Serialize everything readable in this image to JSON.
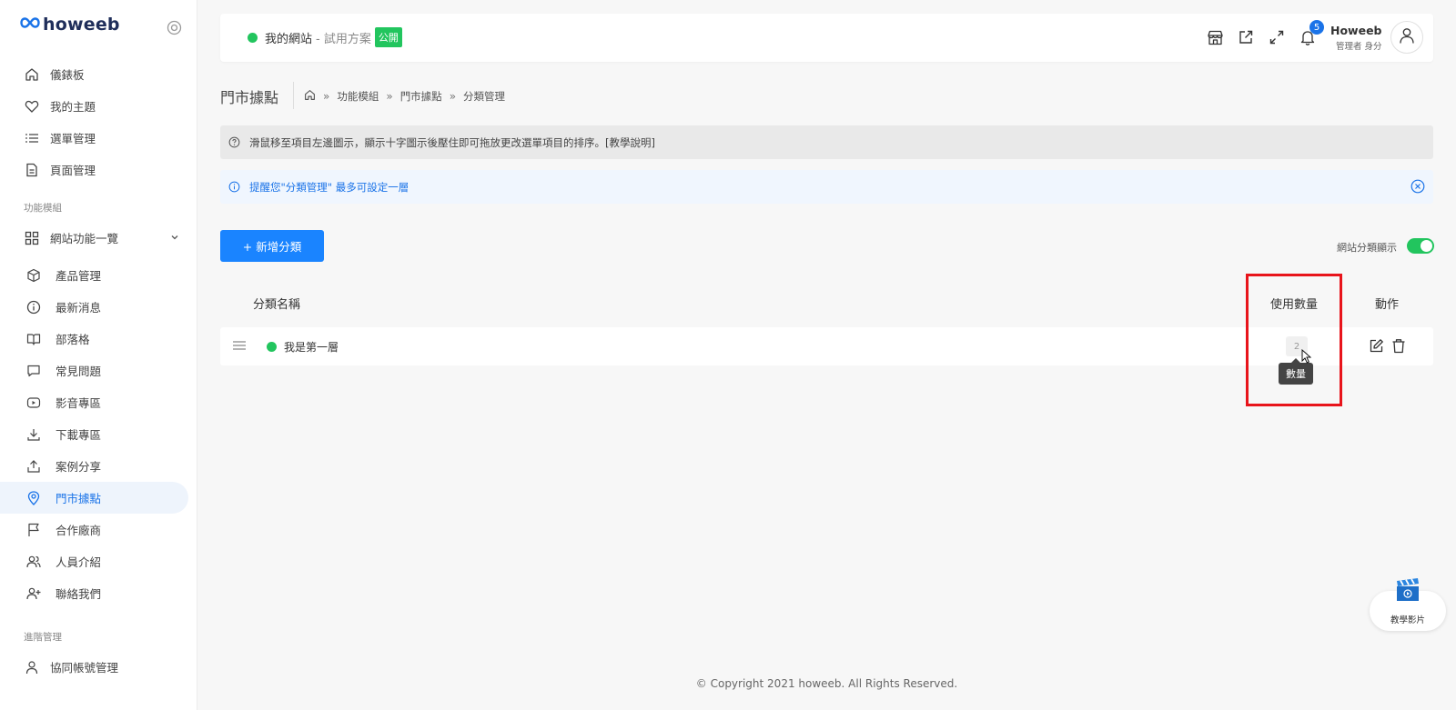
{
  "brand": {
    "name": "howeeb"
  },
  "sidebar": {
    "items": [
      {
        "label": "儀錶板",
        "icon": "home-icon"
      },
      {
        "label": "我的主題",
        "icon": "heart-icon"
      },
      {
        "label": "選單管理",
        "icon": "list-icon"
      },
      {
        "label": "頁面管理",
        "icon": "document-icon"
      }
    ],
    "section_modules": "功能模組",
    "modules_group": {
      "label": "網站功能一覽",
      "icon": "grid-icon"
    },
    "modules": [
      {
        "label": "產品管理",
        "icon": "cube-icon"
      },
      {
        "label": "最新消息",
        "icon": "info-icon"
      },
      {
        "label": "部落格",
        "icon": "book-icon"
      },
      {
        "label": "常見問題",
        "icon": "chat-icon"
      },
      {
        "label": "影音專區",
        "icon": "video-icon"
      },
      {
        "label": "下載專區",
        "icon": "download-icon"
      },
      {
        "label": "案例分享",
        "icon": "share-icon"
      },
      {
        "label": "門市據點",
        "icon": "map-pin-icon",
        "active": true
      },
      {
        "label": "合作廠商",
        "icon": "flag-icon"
      },
      {
        "label": "人員介紹",
        "icon": "users-icon"
      },
      {
        "label": "聯絡我們",
        "icon": "user-plus-icon"
      }
    ],
    "section_admin": "進階管理",
    "admin_items": [
      {
        "label": "協同帳號管理",
        "icon": "user-icon"
      }
    ]
  },
  "topbar": {
    "site_name": "我的網站",
    "site_plan": "- 試用方案",
    "public_badge": "公開",
    "notification_count": "5",
    "user_name": "Howeeb",
    "user_role": "管理者 身分"
  },
  "page": {
    "title": "門市據點",
    "breadcrumb": [
      "功能模組",
      "門市據點",
      "分類管理"
    ],
    "notice_gray": "滑鼠移至項目左邊圖示，顯示十字圖示後壓住即可拖放更改選單項目的排序。[教學說明]",
    "notice_blue": "提醒您\"分類管理\" 最多可設定一層",
    "add_button": "+ 新增分類",
    "toggle_label": "網站分類顯示",
    "table": {
      "headers": {
        "name": "分類名稱",
        "count": "使用數量",
        "action": "動作"
      },
      "rows": [
        {
          "name": "我是第一層",
          "count": "2"
        }
      ]
    },
    "tooltip": "數量",
    "footer": "© Copyright 2021 howeeb. All Rights Reserved.",
    "tutorial_label": "教學影片"
  },
  "colors": {
    "accent": "#1a84ff",
    "success": "#22c55e",
    "highlight": "#e8141b"
  }
}
